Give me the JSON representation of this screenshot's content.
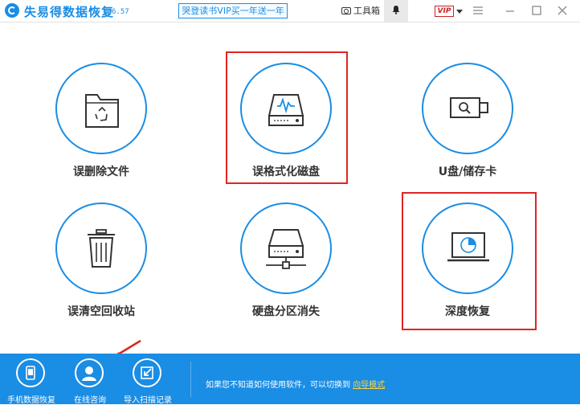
{
  "app": {
    "title": "失易得数据恢复",
    "version": "6.57",
    "promo": "哭登读书VIP买一年送一年"
  },
  "titlebar": {
    "toolbox_label": "工具箱",
    "vip_badge": "VIP"
  },
  "cards": [
    {
      "label": "误删除文件",
      "icon": "folder-recycle-icon"
    },
    {
      "label": "误格式化磁盘",
      "icon": "disk-format-icon"
    },
    {
      "label": "U盘/储存卡",
      "icon": "usb-drive-icon"
    },
    {
      "label": "误清空回收站",
      "icon": "trash-bin-icon"
    },
    {
      "label": "硬盘分区消失",
      "icon": "hard-drive-network-icon"
    },
    {
      "label": "深度恢复",
      "icon": "laptop-scan-icon"
    }
  ],
  "footer": {
    "buttons": [
      {
        "label": "手机数据恢复",
        "icon": "phone-icon"
      },
      {
        "label": "在线咨询",
        "icon": "user-avatar-icon"
      },
      {
        "label": "导入扫描记录",
        "icon": "import-icon"
      }
    ],
    "hint": "如果您不知道如何使用软件，可以切换到",
    "hint_link": "向导模式"
  },
  "colors": {
    "accent": "#1a8de4",
    "highlight": "#e02424",
    "link": "#ffd43b"
  }
}
